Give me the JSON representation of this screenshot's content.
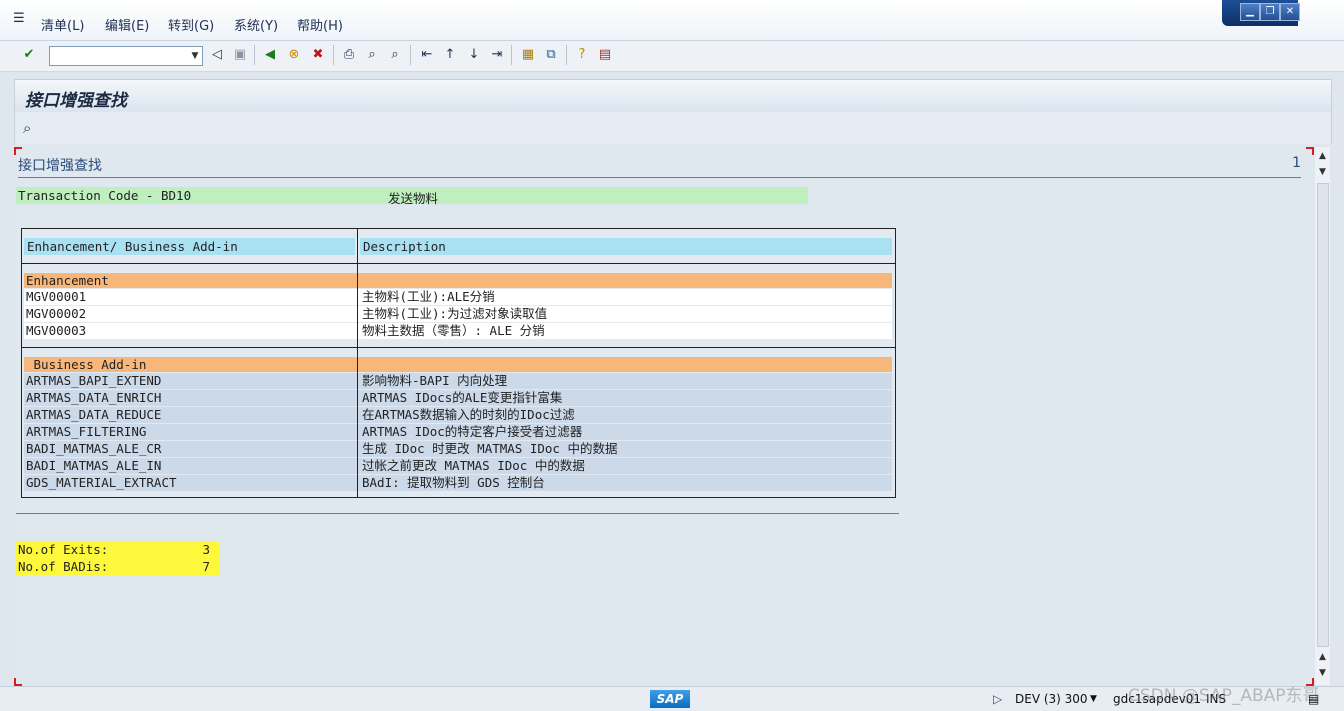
{
  "menubar": {
    "items": [
      "清单(L)",
      "编辑(E)",
      "转到(G)",
      "系统(Y)",
      "帮助(H)"
    ]
  },
  "toolbar": {
    "command_value": ""
  },
  "title": "接口增强查找",
  "list": {
    "header": "接口增强查找",
    "page_number": "1",
    "tcode_label": "Transaction Code - BD10",
    "tcode_text": "发送物料",
    "table": {
      "columns": [
        "Enhancement/ Business Add-in",
        "Description"
      ],
      "enhancement_section": "Enhancement",
      "enhancements": [
        {
          "name": "MGV00001",
          "desc": "主物料(工业):ALE分销"
        },
        {
          "name": "MGV00002",
          "desc": "主物料(工业):为过滤对象读取值"
        },
        {
          "name": "MGV00003",
          "desc": "物料主数据（零售）: ALE 分销"
        }
      ],
      "badi_section": " Business Add-in",
      "badis": [
        {
          "name": "ARTMAS_BAPI_EXTEND",
          "desc": "影响物料-BAPI 内向处理"
        },
        {
          "name": "ARTMAS_DATA_ENRICH",
          "desc": "ARTMAS IDocs的ALE变更指针富集"
        },
        {
          "name": "ARTMAS_DATA_REDUCE",
          "desc": "在ARTMAS数据输入的时刻的IDoc过滤"
        },
        {
          "name": "ARTMAS_FILTERING",
          "desc": "ARTMAS IDoc的特定客户接受者过滤器"
        },
        {
          "name": "BADI_MATMAS_ALE_CR",
          "desc": "生成 IDoc 时更改 MATMAS IDoc 中的数据"
        },
        {
          "name": "BADI_MATMAS_ALE_IN",
          "desc": "过帐之前更改 MATMAS IDoc 中的数据"
        },
        {
          "name": "GDS_MATERIAL_EXTRACT",
          "desc": "BAdI: 提取物料到 GDS 控制台"
        }
      ]
    },
    "exits_label": "No.of Exits:",
    "exits_value": "3",
    "badis_label": "No.of BADis:",
    "badis_value": "7"
  },
  "statusbar": {
    "logo": "SAP",
    "system": "DEV (3) 300",
    "server": "gdc1sapdev01",
    "mode": "INS",
    "watermark": "CSDN @SAP_ABAP东哥"
  },
  "colors": {
    "tcode_bg": "#bfefbf",
    "column_header_bg": "#a9e1f2",
    "section_bg": "#f8b77a",
    "badi_row_bg": "#ccd9e9",
    "count_bg": "#fdf83c"
  }
}
